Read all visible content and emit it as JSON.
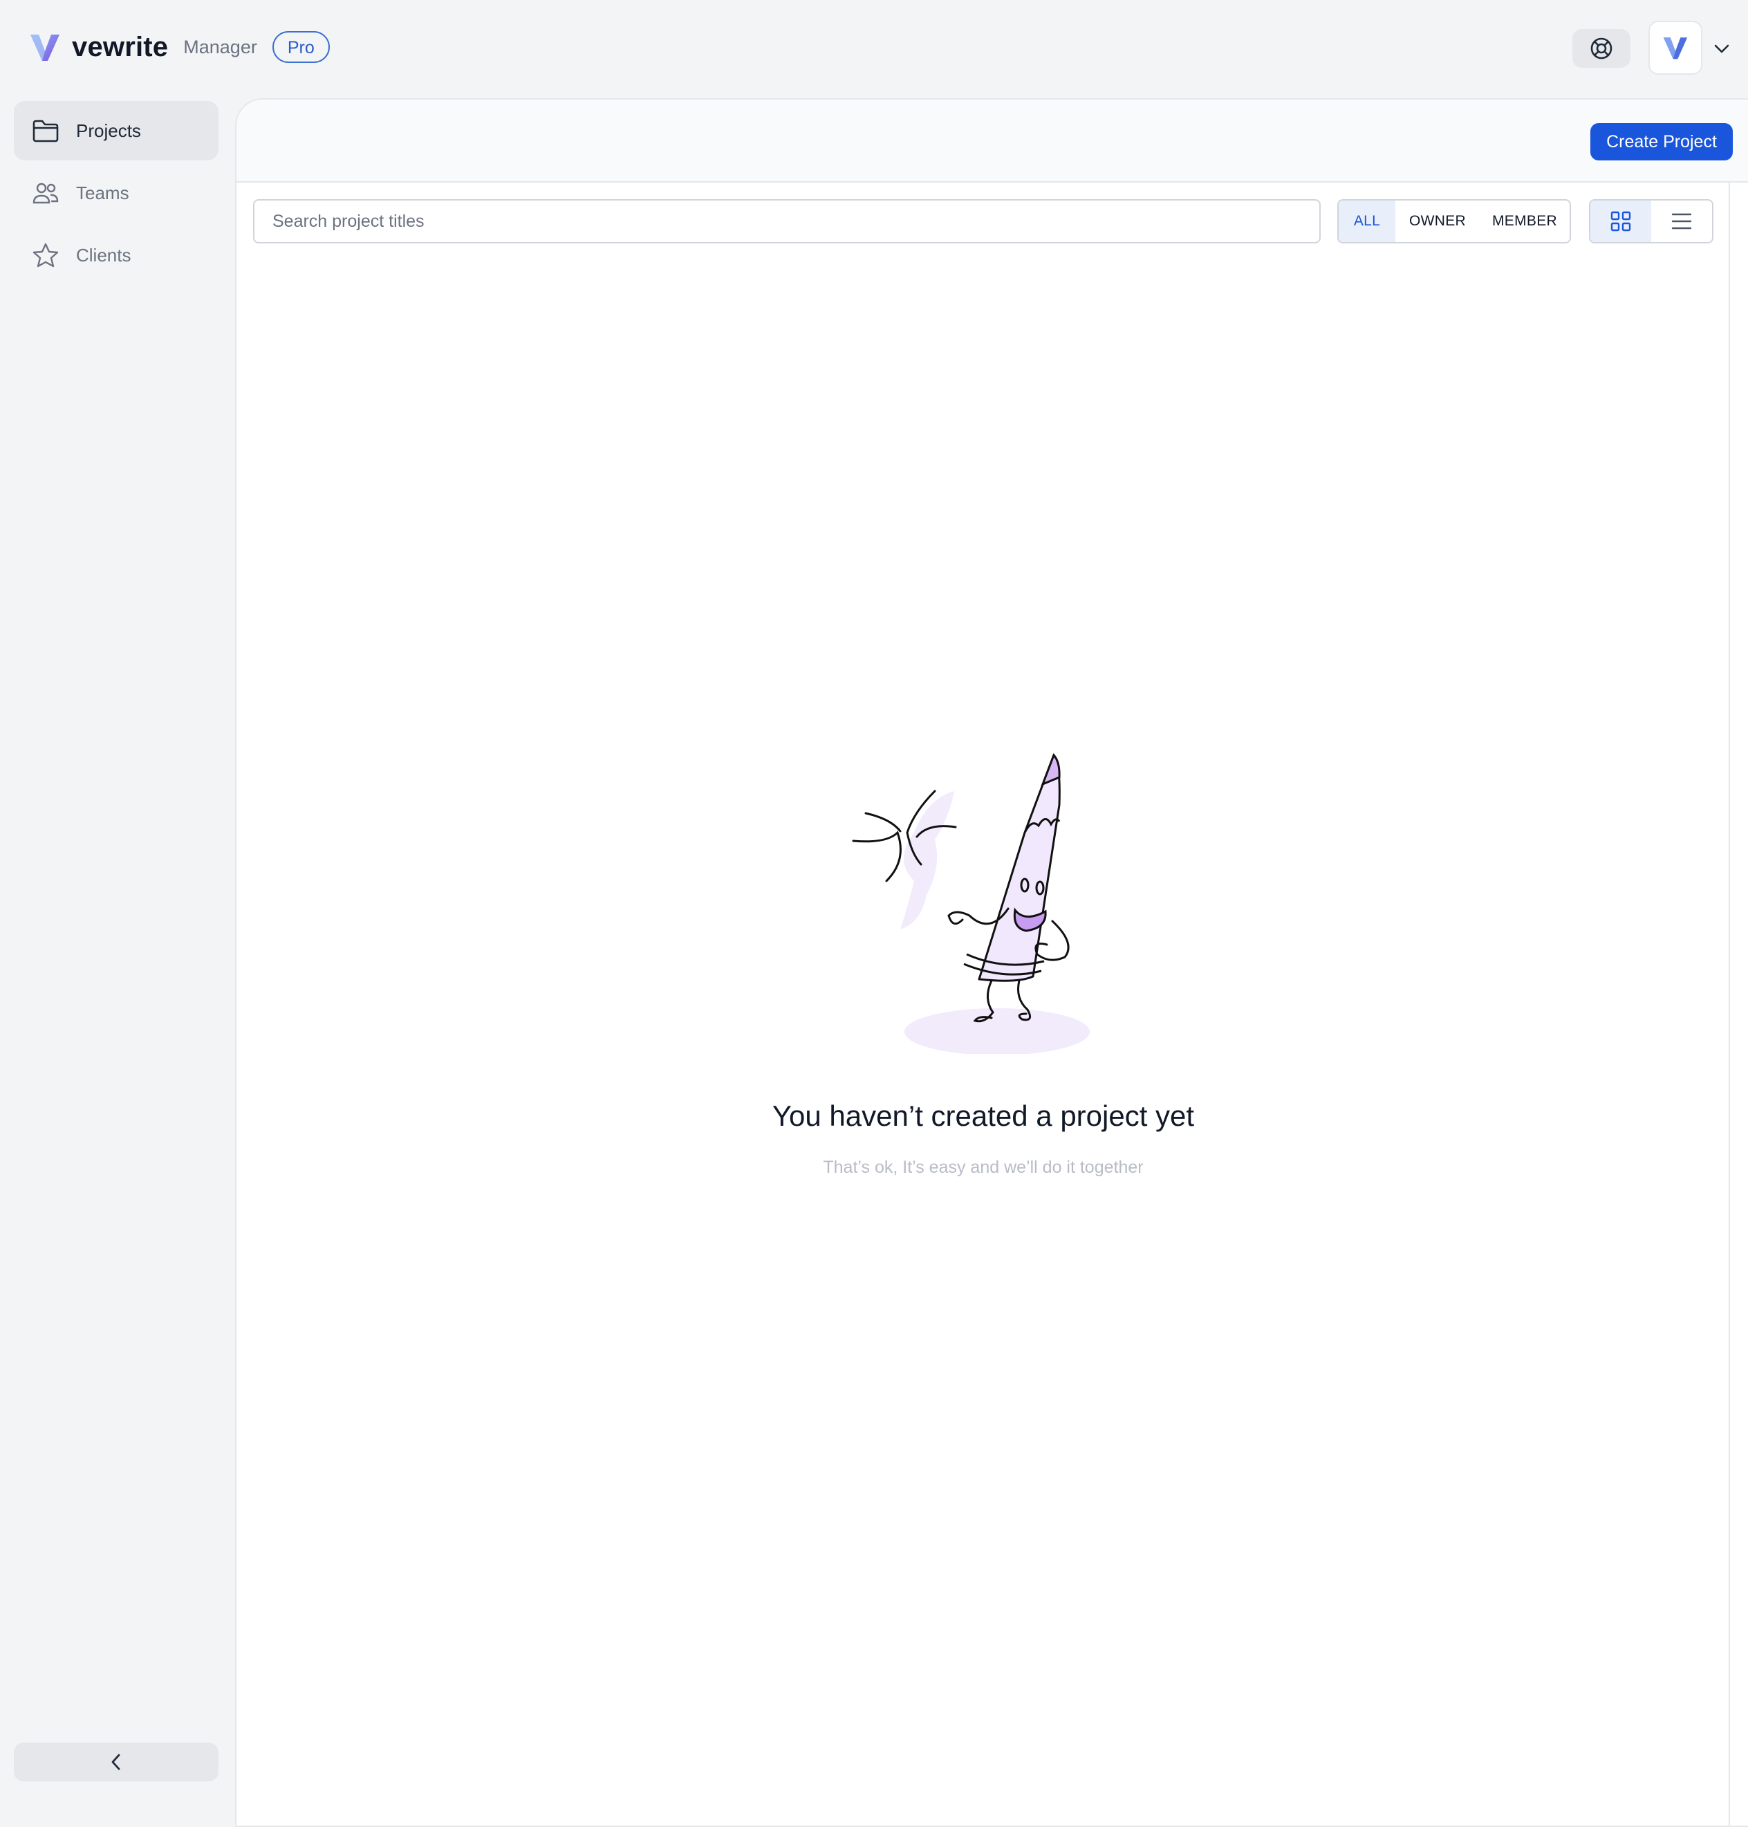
{
  "brand": {
    "name": "vewrite",
    "role": "Manager",
    "plan": "Pro"
  },
  "header": {
    "help_icon": "lifebuoy-icon",
    "avatar_icon": "vewrite-logo-icon",
    "account_chevron_icon": "chevron-down-icon"
  },
  "sidebar": {
    "items": [
      {
        "label": "Projects",
        "icon": "folder-icon",
        "active": true
      },
      {
        "label": "Teams",
        "icon": "users-icon",
        "active": false
      },
      {
        "label": "Clients",
        "icon": "star-icon",
        "active": false
      }
    ],
    "collapse_icon": "chevron-left-icon"
  },
  "main": {
    "create_button_label": "Create Project",
    "search": {
      "placeholder": "Search project titles",
      "value": ""
    },
    "filters": [
      {
        "label": "ALL",
        "selected": true
      },
      {
        "label": "OWNER",
        "selected": false
      },
      {
        "label": "MEMBER",
        "selected": false
      }
    ],
    "views": [
      {
        "icon": "grid-view-icon",
        "selected": true
      },
      {
        "icon": "list-view-icon",
        "selected": false
      }
    ],
    "empty_state": {
      "illustration": "waving-pencil-illustration",
      "title": "You haven’t created a project yet",
      "subtitle": "That’s ok, It’s easy and we’ll do it together"
    }
  },
  "colors": {
    "accent": "#1a56db",
    "background": "#f3f4f6",
    "panel": "#ffffff",
    "illustration_accent": "#e9ddfb"
  }
}
